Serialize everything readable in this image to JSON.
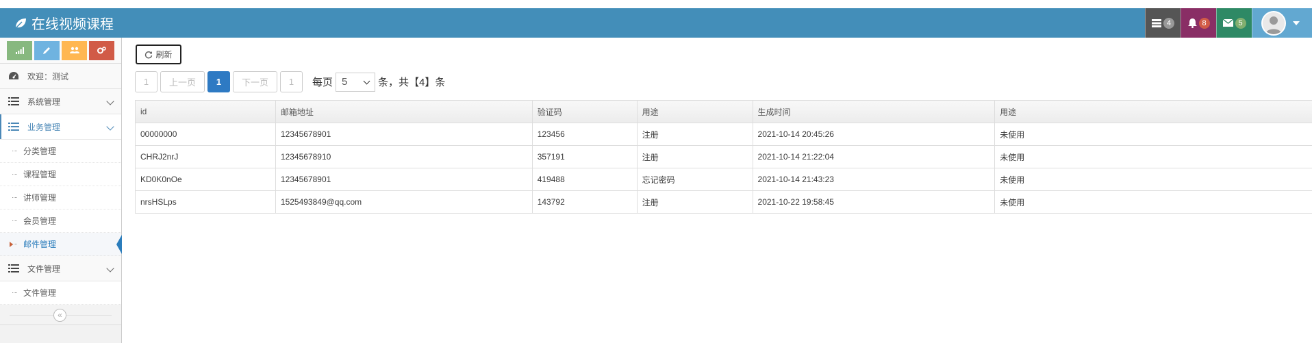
{
  "app": {
    "title": "在线视频课程"
  },
  "header": {
    "tasks_count": "4",
    "notifications_count": "8",
    "messages_count": "5",
    "colors": {
      "navbar": "#438eb9",
      "tasks": "#555555",
      "bell": "#892e65",
      "mail": "#2e8965",
      "user": "#62a8d1"
    }
  },
  "sidebar": {
    "shortcuts": [
      {
        "icon": "signal-icon",
        "color": "#87b87f"
      },
      {
        "icon": "pencil-icon",
        "color": "#6fb3e0"
      },
      {
        "icon": "users-icon",
        "color": "#ffb752"
      },
      {
        "icon": "cogs-icon",
        "color": "#d15b47"
      }
    ],
    "welcome": "欢迎：测试",
    "groups": [
      {
        "label": "系统管理",
        "items": []
      },
      {
        "label": "业务管理",
        "items": [
          "分类管理",
          "课程管理",
          "讲师管理",
          "会员管理",
          "邮件管理"
        ],
        "active_item": "邮件管理"
      },
      {
        "label": "文件管理",
        "items": [
          "文件管理"
        ]
      }
    ],
    "collapse_label": "«"
  },
  "toolbar": {
    "refresh_label": "刷新"
  },
  "pager": {
    "first": "1",
    "prev": "上一页",
    "current": "1",
    "next": "下一页",
    "last": "1",
    "per_page_prefix": "每页",
    "per_page_value": "5",
    "summary": "条，共【4】条"
  },
  "table": {
    "columns": [
      "id",
      "邮箱地址",
      "验证码",
      "用途",
      "生成时间",
      "用途"
    ],
    "rows": [
      [
        "00000000",
        "12345678901",
        "123456",
        "注册",
        "2021-10-14 20:45:26",
        "未使用"
      ],
      [
        "CHRJ2nrJ",
        "12345678910",
        "357191",
        "注册",
        "2021-10-14 21:22:04",
        "未使用"
      ],
      [
        "KD0K0nOe",
        "12345678901",
        "419488",
        "忘记密码",
        "2021-10-14 21:43:23",
        "未使用"
      ],
      [
        "nrsHSLps",
        "1525493849@qq.com",
        "143792",
        "注册",
        "2021-10-22 19:58:45",
        "未使用"
      ]
    ]
  }
}
